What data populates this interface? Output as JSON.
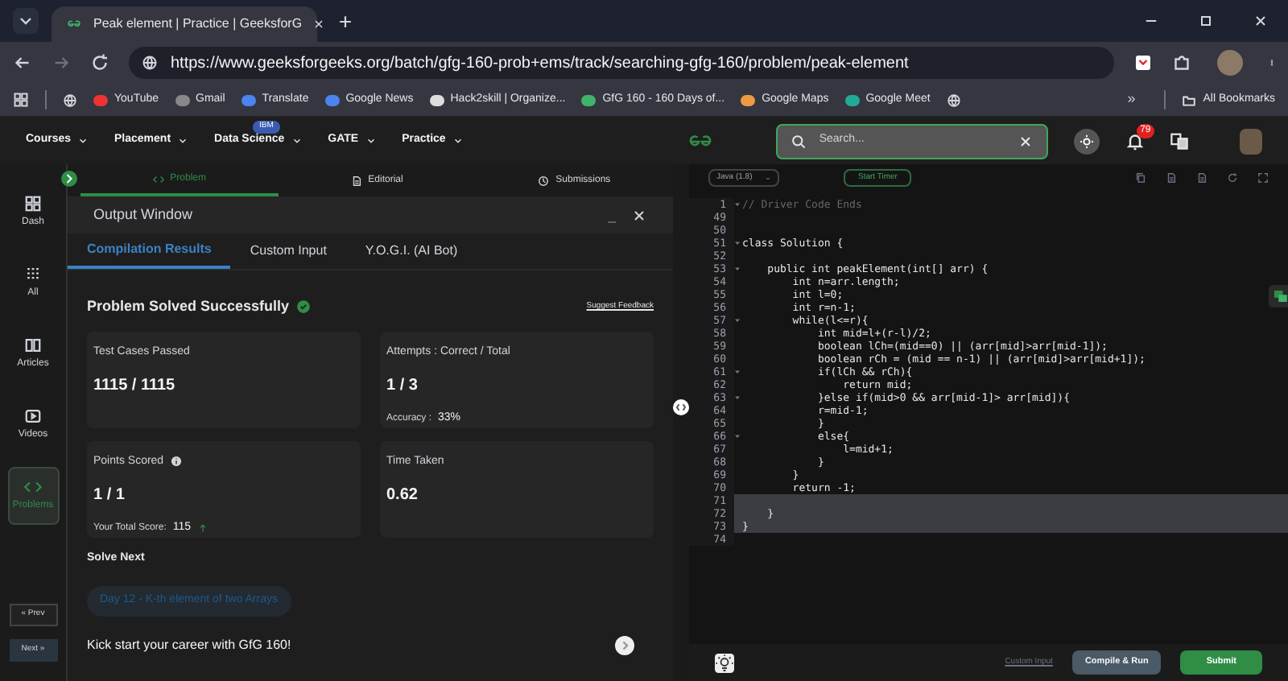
{
  "browser": {
    "tab_title": "Peak element | Practice | GeeksforG",
    "url": "https://www.geeksforgeeks.org/batch/gfg-160-prob+ems/track/searching-gfg-160/problem/peak-element",
    "bookmarks": [
      "YouTube",
      "Gmail",
      "Translate",
      "Google News",
      "Hack2skill | Organize...",
      "GfG 160 - 160 Days of...",
      "Google Maps",
      "Google Meet"
    ],
    "overflow": "»",
    "all_bookmarks": "All Bookmarks"
  },
  "site_nav": {
    "items": [
      {
        "label": "Courses"
      },
      {
        "label": "Placement"
      },
      {
        "label": "Data Science",
        "badge": "IBM"
      },
      {
        "label": "GATE"
      },
      {
        "label": "Practice"
      }
    ],
    "search": {
      "placeholder": "Search..."
    },
    "notifications": "79"
  },
  "sidebar": {
    "items": [
      {
        "label": "Dash",
        "selected": false
      },
      {
        "label": "All",
        "selected": false
      },
      {
        "label": "Articles",
        "selected": false
      },
      {
        "label": "Videos",
        "selected": false
      },
      {
        "label": "Problems",
        "selected": true
      }
    ],
    "prev": "« Prev",
    "next": "Next »"
  },
  "problem_tabs": [
    {
      "label": "Problem",
      "selected": true
    },
    {
      "label": "Editorial",
      "selected": false
    },
    {
      "label": "Submissions",
      "selected": false
    }
  ],
  "output_window": {
    "title": "Output Window",
    "tabs": [
      {
        "label": "Compilation Results",
        "selected": true
      },
      {
        "label": "Custom Input",
        "selected": false
      },
      {
        "label": "Y.O.G.I. (AI Bot)",
        "selected": false
      }
    ],
    "status": "Problem Solved Successfully",
    "feedback_link": "Suggest Feedback",
    "cards": [
      {
        "label": "Test Cases Passed",
        "value": "1115 / 1115"
      },
      {
        "label": "Attempts : Correct / Total",
        "value": "1 / 3",
        "note_label": "Accuracy :",
        "note_value": "33%"
      },
      {
        "label": "Points Scored",
        "value": "1 / 1",
        "note_label": "Your Total Score:",
        "note_value": "115",
        "info": true
      },
      {
        "label": "Time Taken",
        "value": "0.62"
      }
    ],
    "solve_next_title": "Solve Next",
    "next_problem": "Day 12 - K-th element of two Arrays",
    "promo": "Kick start your career with GfG 160!"
  },
  "editor": {
    "language": "Java (1.8)",
    "timer": "Start Timer",
    "lines": [
      {
        "number": "1",
        "text": "// Driver Code Ends",
        "kind": "comment",
        "fold": true,
        "selected": false
      },
      {
        "number": "49",
        "kind": "code",
        "fold": false,
        "selected": false
      },
      {
        "number": "50",
        "kind": "code",
        "fold": false,
        "selected": false
      },
      {
        "number": "51",
        "text": "class Solution {",
        "kind": "code",
        "fold": true,
        "selected": false
      },
      {
        "number": "52",
        "kind": "code",
        "fold": false,
        "selected": false
      },
      {
        "number": "53",
        "text": "    public int peakElement(int[] arr) {",
        "kind": "code",
        "fold": true,
        "selected": false
      },
      {
        "number": "54",
        "text": "        int n=arr.length;",
        "kind": "code",
        "fold": false,
        "selected": false
      },
      {
        "number": "55",
        "text": "        int l=0;",
        "kind": "code",
        "fold": false,
        "selected": false
      },
      {
        "number": "56",
        "text": "        int r=n-1;",
        "kind": "code",
        "fold": false,
        "selected": false
      },
      {
        "number": "57",
        "text": "        while(l<=r){",
        "kind": "code",
        "fold": true,
        "selected": false
      },
      {
        "number": "58",
        "text": "            int mid=l+(r-l)/2;",
        "kind": "code",
        "fold": false,
        "selected": false
      },
      {
        "number": "59",
        "text": "            boolean lCh=(mid==0) || (arr[mid]>arr[mid-1]);",
        "kind": "code",
        "fold": false,
        "selected": false
      },
      {
        "number": "60",
        "text": "            boolean rCh = (mid == n-1) || (arr[mid]>arr[mid+1]);",
        "kind": "code",
        "fold": false,
        "selected": false
      },
      {
        "number": "61",
        "text": "            if(lCh && rCh){",
        "kind": "code",
        "fold": true,
        "selected": false
      },
      {
        "number": "62",
        "text": "                return mid;",
        "kind": "code",
        "fold": false,
        "selected": false
      },
      {
        "number": "63",
        "text": "            }else if(mid>0 && arr[mid-1]> arr[mid]){",
        "kind": "code",
        "fold": true,
        "selected": false
      },
      {
        "number": "64",
        "text": "            r=mid-1;",
        "kind": "code",
        "fold": false,
        "selected": false
      },
      {
        "number": "65",
        "text": "            }",
        "kind": "code",
        "fold": false,
        "selected": false
      },
      {
        "number": "66",
        "text": "            else{",
        "kind": "code",
        "fold": true,
        "selected": false
      },
      {
        "number": "67",
        "text": "                l=mid+1;",
        "kind": "code",
        "fold": false,
        "selected": false
      },
      {
        "number": "68",
        "text": "            }",
        "kind": "code",
        "fold": false,
        "selected": false
      },
      {
        "number": "69",
        "text": "        }",
        "kind": "code",
        "fold": false,
        "selected": false
      },
      {
        "number": "70",
        "text": "        return -1;",
        "kind": "code",
        "fold": false,
        "selected": false
      },
      {
        "number": "71",
        "kind": "code",
        "fold": false,
        "selected": true
      },
      {
        "number": "72",
        "text": "    }",
        "kind": "code",
        "fold": false,
        "selected": true
      },
      {
        "number": "73",
        "text": "}",
        "kind": "code",
        "fold": false,
        "selected": true
      },
      {
        "number": "74",
        "kind": "code",
        "fold": false,
        "selected": false
      }
    ],
    "custom_input": "Custom Input",
    "compile": "Compile & Run",
    "submit": "Submit"
  }
}
